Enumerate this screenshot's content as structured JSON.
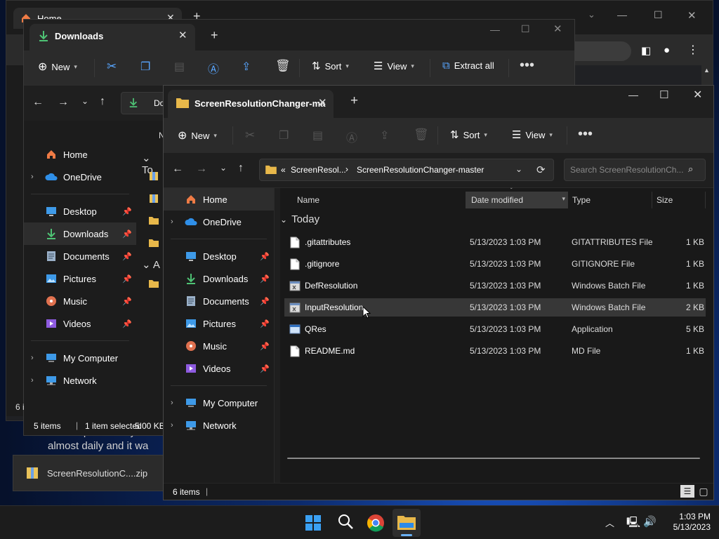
{
  "chrome": {
    "tab_title": "Home",
    "page_text_line1": "this script basically be",
    "page_text_line2": "almost daily and it wa"
  },
  "download_bar": {
    "file_name": "ScreenResolutionC....zip"
  },
  "downloads_window": {
    "tab_title": "Downloads",
    "toolbar": {
      "new_label": "New",
      "sort_label": "Sort",
      "view_label": "View",
      "extract_label": "Extract all"
    },
    "address_partial": "Do",
    "list_partial": {
      "col_name": "N",
      "group_today": "To",
      "group_other": "A"
    },
    "nav": [
      {
        "label": "Home",
        "icon": "home-icon"
      },
      {
        "label": "OneDrive",
        "icon": "onedrive-icon"
      },
      {
        "label": "Desktop",
        "icon": "desktop-icon",
        "pinned": true
      },
      {
        "label": "Downloads",
        "icon": "download-icon",
        "pinned": true
      },
      {
        "label": "Documents",
        "icon": "documents-icon",
        "pinned": true
      },
      {
        "label": "Pictures",
        "icon": "pictures-icon",
        "pinned": true
      },
      {
        "label": "Music",
        "icon": "music-icon",
        "pinned": true
      },
      {
        "label": "Videos",
        "icon": "videos-icon",
        "pinned": true
      },
      {
        "label": "My Computer",
        "icon": "computer-icon"
      },
      {
        "label": "Network",
        "icon": "network-icon"
      }
    ],
    "status": {
      "items": "5 items",
      "selected": "1 item selected",
      "size": "5.00 KB",
      "other_items": "6 i"
    }
  },
  "front_window": {
    "tab_title": "ScreenResolutionChanger-ma",
    "toolbar": {
      "new_label": "New",
      "sort_label": "Sort",
      "view_label": "View"
    },
    "breadcrumb": {
      "overflow": "«",
      "parent": "ScreenResol...",
      "current": "ScreenResolutionChanger-master"
    },
    "search_placeholder": "Search ScreenResolutionCh...",
    "columns": {
      "name": "Name",
      "date": "Date modified",
      "type": "Type",
      "size": "Size"
    },
    "group_label": "Today",
    "files": [
      {
        "name": ".gitattributes",
        "date": "5/13/2023 1:03 PM",
        "type": "GITATTRIBUTES File",
        "size": "1 KB",
        "icon": "text-file-icon",
        "selected": false
      },
      {
        "name": ".gitignore",
        "date": "5/13/2023 1:03 PM",
        "type": "GITIGNORE File",
        "size": "1 KB",
        "icon": "text-file-icon",
        "selected": false
      },
      {
        "name": "DefResolution",
        "date": "5/13/2023 1:03 PM",
        "type": "Windows Batch File",
        "size": "1 KB",
        "icon": "batch-file-icon",
        "selected": false
      },
      {
        "name": "InputResolution",
        "date": "5/13/2023 1:03 PM",
        "type": "Windows Batch File",
        "size": "2 KB",
        "icon": "batch-file-icon",
        "selected": true
      },
      {
        "name": "QRes",
        "date": "5/13/2023 1:03 PM",
        "type": "Application",
        "size": "5 KB",
        "icon": "application-icon",
        "selected": false
      },
      {
        "name": "README.md",
        "date": "5/13/2023 1:03 PM",
        "type": "MD File",
        "size": "1 KB",
        "icon": "text-file-icon",
        "selected": false
      }
    ],
    "nav": [
      {
        "label": "Home",
        "icon": "home-icon"
      },
      {
        "label": "OneDrive",
        "icon": "onedrive-icon"
      },
      {
        "label": "Desktop",
        "icon": "desktop-icon",
        "pinned": true
      },
      {
        "label": "Downloads",
        "icon": "download-icon",
        "pinned": true
      },
      {
        "label": "Documents",
        "icon": "documents-icon",
        "pinned": true
      },
      {
        "label": "Pictures",
        "icon": "pictures-icon",
        "pinned": true
      },
      {
        "label": "Music",
        "icon": "music-icon",
        "pinned": true
      },
      {
        "label": "Videos",
        "icon": "videos-icon",
        "pinned": true
      },
      {
        "label": "My Computer",
        "icon": "computer-icon"
      },
      {
        "label": "Network",
        "icon": "network-icon"
      }
    ],
    "status": {
      "items": "6 items"
    }
  },
  "taskbar": {
    "time": "1:03 PM",
    "date": "5/13/2023",
    "apps": [
      "start-icon",
      "search-icon",
      "chrome-icon",
      "file-explorer-icon"
    ]
  },
  "colors": {
    "accent": "#0078d4",
    "folder": "#e8b84a",
    "download_green": "#4ec274",
    "selection": "#373737"
  }
}
